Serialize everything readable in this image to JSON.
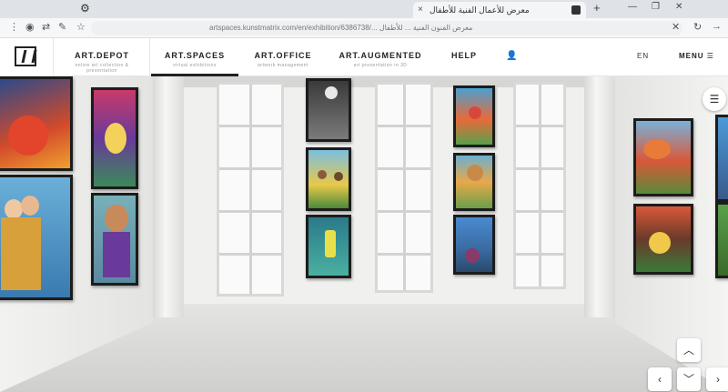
{
  "browser": {
    "tab_title": "معرض للأعمال الفنية للأطفال",
    "address": "artspaces.kunstmatrix.com/en/exhibition/6386738/... معرض الفنون الفنية ... للأطفال"
  },
  "nav": {
    "items": [
      {
        "label": "ART.DEPOT",
        "sub": "online art collection & presentation"
      },
      {
        "label": "ART.SPACES",
        "sub": "virtual exhibitions"
      },
      {
        "label": "ART.OFFICE",
        "sub": "artwork management"
      },
      {
        "label": "ART.AUGMENTED",
        "sub": "art presentation in 3D"
      },
      {
        "label": "HELP",
        "sub": ""
      }
    ],
    "active_index": 1,
    "lang": "EN",
    "menu": "MENU"
  },
  "icons": {
    "menu": "hamburger-icon",
    "nav_up": "arrow-up-icon",
    "nav_down": "arrow-down-icon",
    "nav_left": "arrow-left-icon",
    "nav_right": "arrow-right-icon"
  }
}
